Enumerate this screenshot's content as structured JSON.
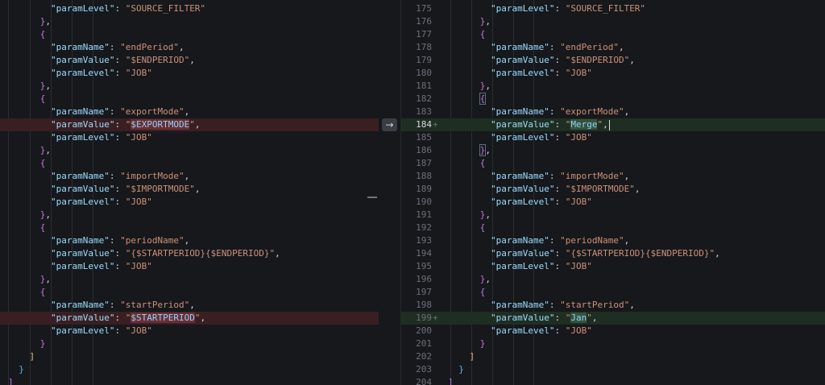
{
  "left": {
    "lines": [
      {
        "indent": "        ",
        "segs": [
          [
            "k",
            "\"paramLevel\""
          ],
          [
            "p",
            ": "
          ],
          [
            "s",
            "\"SOURCE_FILTER\""
          ]
        ]
      },
      {
        "indent": "      ",
        "segs": [
          [
            "bm",
            "}"
          ],
          [
            "p",
            ","
          ]
        ]
      },
      {
        "indent": "      ",
        "segs": [
          [
            "bm",
            "{"
          ]
        ]
      },
      {
        "indent": "        ",
        "segs": [
          [
            "k",
            "\"paramName\""
          ],
          [
            "p",
            ": "
          ],
          [
            "s",
            "\"endPeriod\""
          ],
          [
            "p",
            ","
          ]
        ]
      },
      {
        "indent": "        ",
        "segs": [
          [
            "k",
            "\"paramValue\""
          ],
          [
            "p",
            ": "
          ],
          [
            "s",
            "\"$ENDPERIOD\""
          ],
          [
            "p",
            ","
          ]
        ]
      },
      {
        "indent": "        ",
        "segs": [
          [
            "k",
            "\"paramLevel\""
          ],
          [
            "p",
            ": "
          ],
          [
            "s",
            "\"JOB\""
          ]
        ]
      },
      {
        "indent": "      ",
        "segs": [
          [
            "bm",
            "}"
          ],
          [
            "p",
            ","
          ]
        ]
      },
      {
        "indent": "      ",
        "segs": [
          [
            "bm",
            "{"
          ]
        ]
      },
      {
        "indent": "        ",
        "segs": [
          [
            "k",
            "\"paramName\""
          ],
          [
            "p",
            ": "
          ],
          [
            "s",
            "\"exportMode\""
          ],
          [
            "p",
            ","
          ]
        ]
      },
      {
        "indent": "        ",
        "state": "removed",
        "segs": [
          [
            "k",
            "\"paramValue\""
          ],
          [
            "p",
            ": "
          ],
          [
            "s",
            "\""
          ],
          [
            "hlr",
            "$EXPORTMODE"
          ],
          [
            "s",
            "\""
          ],
          [
            "p",
            ","
          ]
        ]
      },
      {
        "indent": "        ",
        "segs": [
          [
            "k",
            "\"paramLevel\""
          ],
          [
            "p",
            ": "
          ],
          [
            "s",
            "\"JOB\""
          ]
        ]
      },
      {
        "indent": "      ",
        "segs": [
          [
            "bm",
            "}"
          ],
          [
            "p",
            ","
          ]
        ]
      },
      {
        "indent": "      ",
        "segs": [
          [
            "bm",
            "{"
          ]
        ]
      },
      {
        "indent": "        ",
        "segs": [
          [
            "k",
            "\"paramName\""
          ],
          [
            "p",
            ": "
          ],
          [
            "s",
            "\"importMode\""
          ],
          [
            "p",
            ","
          ]
        ]
      },
      {
        "indent": "        ",
        "segs": [
          [
            "k",
            "\"paramValue\""
          ],
          [
            "p",
            ": "
          ],
          [
            "s",
            "\"$IMPORTMODE\""
          ],
          [
            "p",
            ","
          ]
        ]
      },
      {
        "indent": "        ",
        "segs": [
          [
            "k",
            "\"paramLevel\""
          ],
          [
            "p",
            ": "
          ],
          [
            "s",
            "\"JOB\""
          ]
        ]
      },
      {
        "indent": "      ",
        "segs": [
          [
            "bm",
            "}"
          ],
          [
            "p",
            ","
          ]
        ]
      },
      {
        "indent": "      ",
        "segs": [
          [
            "bm",
            "{"
          ]
        ]
      },
      {
        "indent": "        ",
        "segs": [
          [
            "k",
            "\"paramName\""
          ],
          [
            "p",
            ": "
          ],
          [
            "s",
            "\"periodName\""
          ],
          [
            "p",
            ","
          ]
        ]
      },
      {
        "indent": "        ",
        "segs": [
          [
            "k",
            "\"paramValue\""
          ],
          [
            "p",
            ": "
          ],
          [
            "s",
            "\"{$STARTPERIOD}{$ENDPERIOD}\""
          ],
          [
            "p",
            ","
          ]
        ]
      },
      {
        "indent": "        ",
        "segs": [
          [
            "k",
            "\"paramLevel\""
          ],
          [
            "p",
            ": "
          ],
          [
            "s",
            "\"JOB\""
          ]
        ]
      },
      {
        "indent": "      ",
        "segs": [
          [
            "bm",
            "}"
          ],
          [
            "p",
            ","
          ]
        ]
      },
      {
        "indent": "      ",
        "segs": [
          [
            "bm",
            "{"
          ]
        ]
      },
      {
        "indent": "        ",
        "segs": [
          [
            "k",
            "\"paramName\""
          ],
          [
            "p",
            ": "
          ],
          [
            "s",
            "\"startPeriod\""
          ],
          [
            "p",
            ","
          ]
        ]
      },
      {
        "indent": "        ",
        "state": "removed",
        "segs": [
          [
            "k",
            "\"paramValue\""
          ],
          [
            "p",
            ": "
          ],
          [
            "s",
            "\""
          ],
          [
            "hlr",
            "$STARTPERIOD"
          ],
          [
            "s",
            "\""
          ],
          [
            "p",
            ","
          ]
        ]
      },
      {
        "indent": "        ",
        "segs": [
          [
            "k",
            "\"paramLevel\""
          ],
          [
            "p",
            ": "
          ],
          [
            "s",
            "\"JOB\""
          ]
        ]
      },
      {
        "indent": "      ",
        "segs": [
          [
            "bm",
            "}"
          ]
        ]
      },
      {
        "indent": "    ",
        "segs": [
          [
            "by",
            "]"
          ]
        ]
      },
      {
        "indent": "  ",
        "segs": [
          [
            "bb",
            "}"
          ]
        ]
      },
      {
        "indent": "",
        "segs": [
          [
            "bm",
            "]"
          ]
        ]
      }
    ]
  },
  "right": {
    "lines": [
      {
        "n": "175",
        "indent": "        ",
        "segs": [
          [
            "k",
            "\"paramLevel\""
          ],
          [
            "p",
            ": "
          ],
          [
            "s",
            "\"SOURCE_FILTER\""
          ]
        ]
      },
      {
        "n": "176",
        "indent": "      ",
        "segs": [
          [
            "bm",
            "}"
          ],
          [
            "p",
            ","
          ]
        ]
      },
      {
        "n": "177",
        "indent": "      ",
        "segs": [
          [
            "bm",
            "{"
          ]
        ]
      },
      {
        "n": "178",
        "indent": "        ",
        "segs": [
          [
            "k",
            "\"paramName\""
          ],
          [
            "p",
            ": "
          ],
          [
            "s",
            "\"endPeriod\""
          ],
          [
            "p",
            ","
          ]
        ]
      },
      {
        "n": "179",
        "indent": "        ",
        "segs": [
          [
            "k",
            "\"paramValue\""
          ],
          [
            "p",
            ": "
          ],
          [
            "s",
            "\"$ENDPERIOD\""
          ],
          [
            "p",
            ","
          ]
        ]
      },
      {
        "n": "180",
        "indent": "        ",
        "segs": [
          [
            "k",
            "\"paramLevel\""
          ],
          [
            "p",
            ": "
          ],
          [
            "s",
            "\"JOB\""
          ]
        ]
      },
      {
        "n": "181",
        "indent": "      ",
        "segs": [
          [
            "bm",
            "}"
          ],
          [
            "p",
            ","
          ]
        ]
      },
      {
        "n": "182",
        "indent": "      ",
        "segs": [
          [
            "bmh",
            "{"
          ]
        ]
      },
      {
        "n": "183",
        "indent": "        ",
        "segs": [
          [
            "k",
            "\"paramName\""
          ],
          [
            "p",
            ": "
          ],
          [
            "s",
            "\"exportMode\""
          ],
          [
            "p",
            ","
          ]
        ]
      },
      {
        "n": "184",
        "indent": "        ",
        "state": "added",
        "mark": "+",
        "cur": true,
        "segs": [
          [
            "k",
            "\"paramValue\""
          ],
          [
            "p",
            ": "
          ],
          [
            "s",
            "\""
          ],
          [
            "hlg",
            "Merge"
          ],
          [
            "s",
            "\""
          ],
          [
            "p",
            ","
          ],
          [
            "cursor",
            ""
          ]
        ]
      },
      {
        "n": "185",
        "indent": "        ",
        "segs": [
          [
            "k",
            "\"paramLevel\""
          ],
          [
            "p",
            ": "
          ],
          [
            "s",
            "\"JOB\""
          ]
        ]
      },
      {
        "n": "186",
        "indent": "      ",
        "segs": [
          [
            "bmh",
            "}"
          ],
          [
            "p",
            ","
          ]
        ]
      },
      {
        "n": "187",
        "indent": "      ",
        "segs": [
          [
            "bm",
            "{"
          ]
        ]
      },
      {
        "n": "188",
        "indent": "        ",
        "segs": [
          [
            "k",
            "\"paramName\""
          ],
          [
            "p",
            ": "
          ],
          [
            "s",
            "\"importMode\""
          ],
          [
            "p",
            ","
          ]
        ]
      },
      {
        "n": "189",
        "indent": "        ",
        "segs": [
          [
            "k",
            "\"paramValue\""
          ],
          [
            "p",
            ": "
          ],
          [
            "s",
            "\"$IMPORTMODE\""
          ],
          [
            "p",
            ","
          ]
        ]
      },
      {
        "n": "190",
        "indent": "        ",
        "segs": [
          [
            "k",
            "\"paramLevel\""
          ],
          [
            "p",
            ": "
          ],
          [
            "s",
            "\"JOB\""
          ]
        ]
      },
      {
        "n": "191",
        "indent": "      ",
        "segs": [
          [
            "bm",
            "}"
          ],
          [
            "p",
            ","
          ]
        ]
      },
      {
        "n": "192",
        "indent": "      ",
        "segs": [
          [
            "bm",
            "{"
          ]
        ]
      },
      {
        "n": "193",
        "indent": "        ",
        "segs": [
          [
            "k",
            "\"paramName\""
          ],
          [
            "p",
            ": "
          ],
          [
            "s",
            "\"periodName\""
          ],
          [
            "p",
            ","
          ]
        ]
      },
      {
        "n": "194",
        "indent": "        ",
        "segs": [
          [
            "k",
            "\"paramValue\""
          ],
          [
            "p",
            ": "
          ],
          [
            "s",
            "\"{$STARTPERIOD}{$ENDPERIOD}\""
          ],
          [
            "p",
            ","
          ]
        ]
      },
      {
        "n": "195",
        "indent": "        ",
        "segs": [
          [
            "k",
            "\"paramLevel\""
          ],
          [
            "p",
            ": "
          ],
          [
            "s",
            "\"JOB\""
          ]
        ]
      },
      {
        "n": "196",
        "indent": "      ",
        "segs": [
          [
            "bm",
            "}"
          ],
          [
            "p",
            ","
          ]
        ]
      },
      {
        "n": "197",
        "indent": "      ",
        "segs": [
          [
            "bm",
            "{"
          ]
        ]
      },
      {
        "n": "198",
        "indent": "        ",
        "segs": [
          [
            "k",
            "\"paramName\""
          ],
          [
            "p",
            ": "
          ],
          [
            "s",
            "\"startPeriod\""
          ],
          [
            "p",
            ","
          ]
        ]
      },
      {
        "n": "199",
        "indent": "        ",
        "state": "added",
        "mark": "+",
        "segs": [
          [
            "k",
            "\"paramValue\""
          ],
          [
            "p",
            ": "
          ],
          [
            "s",
            "\""
          ],
          [
            "hlg",
            "Jan"
          ],
          [
            "s",
            "\""
          ],
          [
            "p",
            ","
          ]
        ]
      },
      {
        "n": "200",
        "indent": "        ",
        "segs": [
          [
            "k",
            "\"paramLevel\""
          ],
          [
            "p",
            ": "
          ],
          [
            "s",
            "\"JOB\""
          ]
        ]
      },
      {
        "n": "201",
        "indent": "      ",
        "segs": [
          [
            "bm",
            "}"
          ]
        ]
      },
      {
        "n": "202",
        "indent": "    ",
        "segs": [
          [
            "by",
            "]"
          ]
        ]
      },
      {
        "n": "203",
        "indent": "  ",
        "segs": [
          [
            "bb",
            "}"
          ]
        ]
      },
      {
        "n": "204",
        "indent": "",
        "segs": [
          [
            "bm",
            "]"
          ]
        ]
      }
    ]
  },
  "revert_icon": "arrow-right-icon",
  "colors": {
    "removed_bg": "#3a1f22",
    "added_bg": "#1f2e22",
    "removed_word": "#6a2e33",
    "added_word": "#35523b"
  }
}
